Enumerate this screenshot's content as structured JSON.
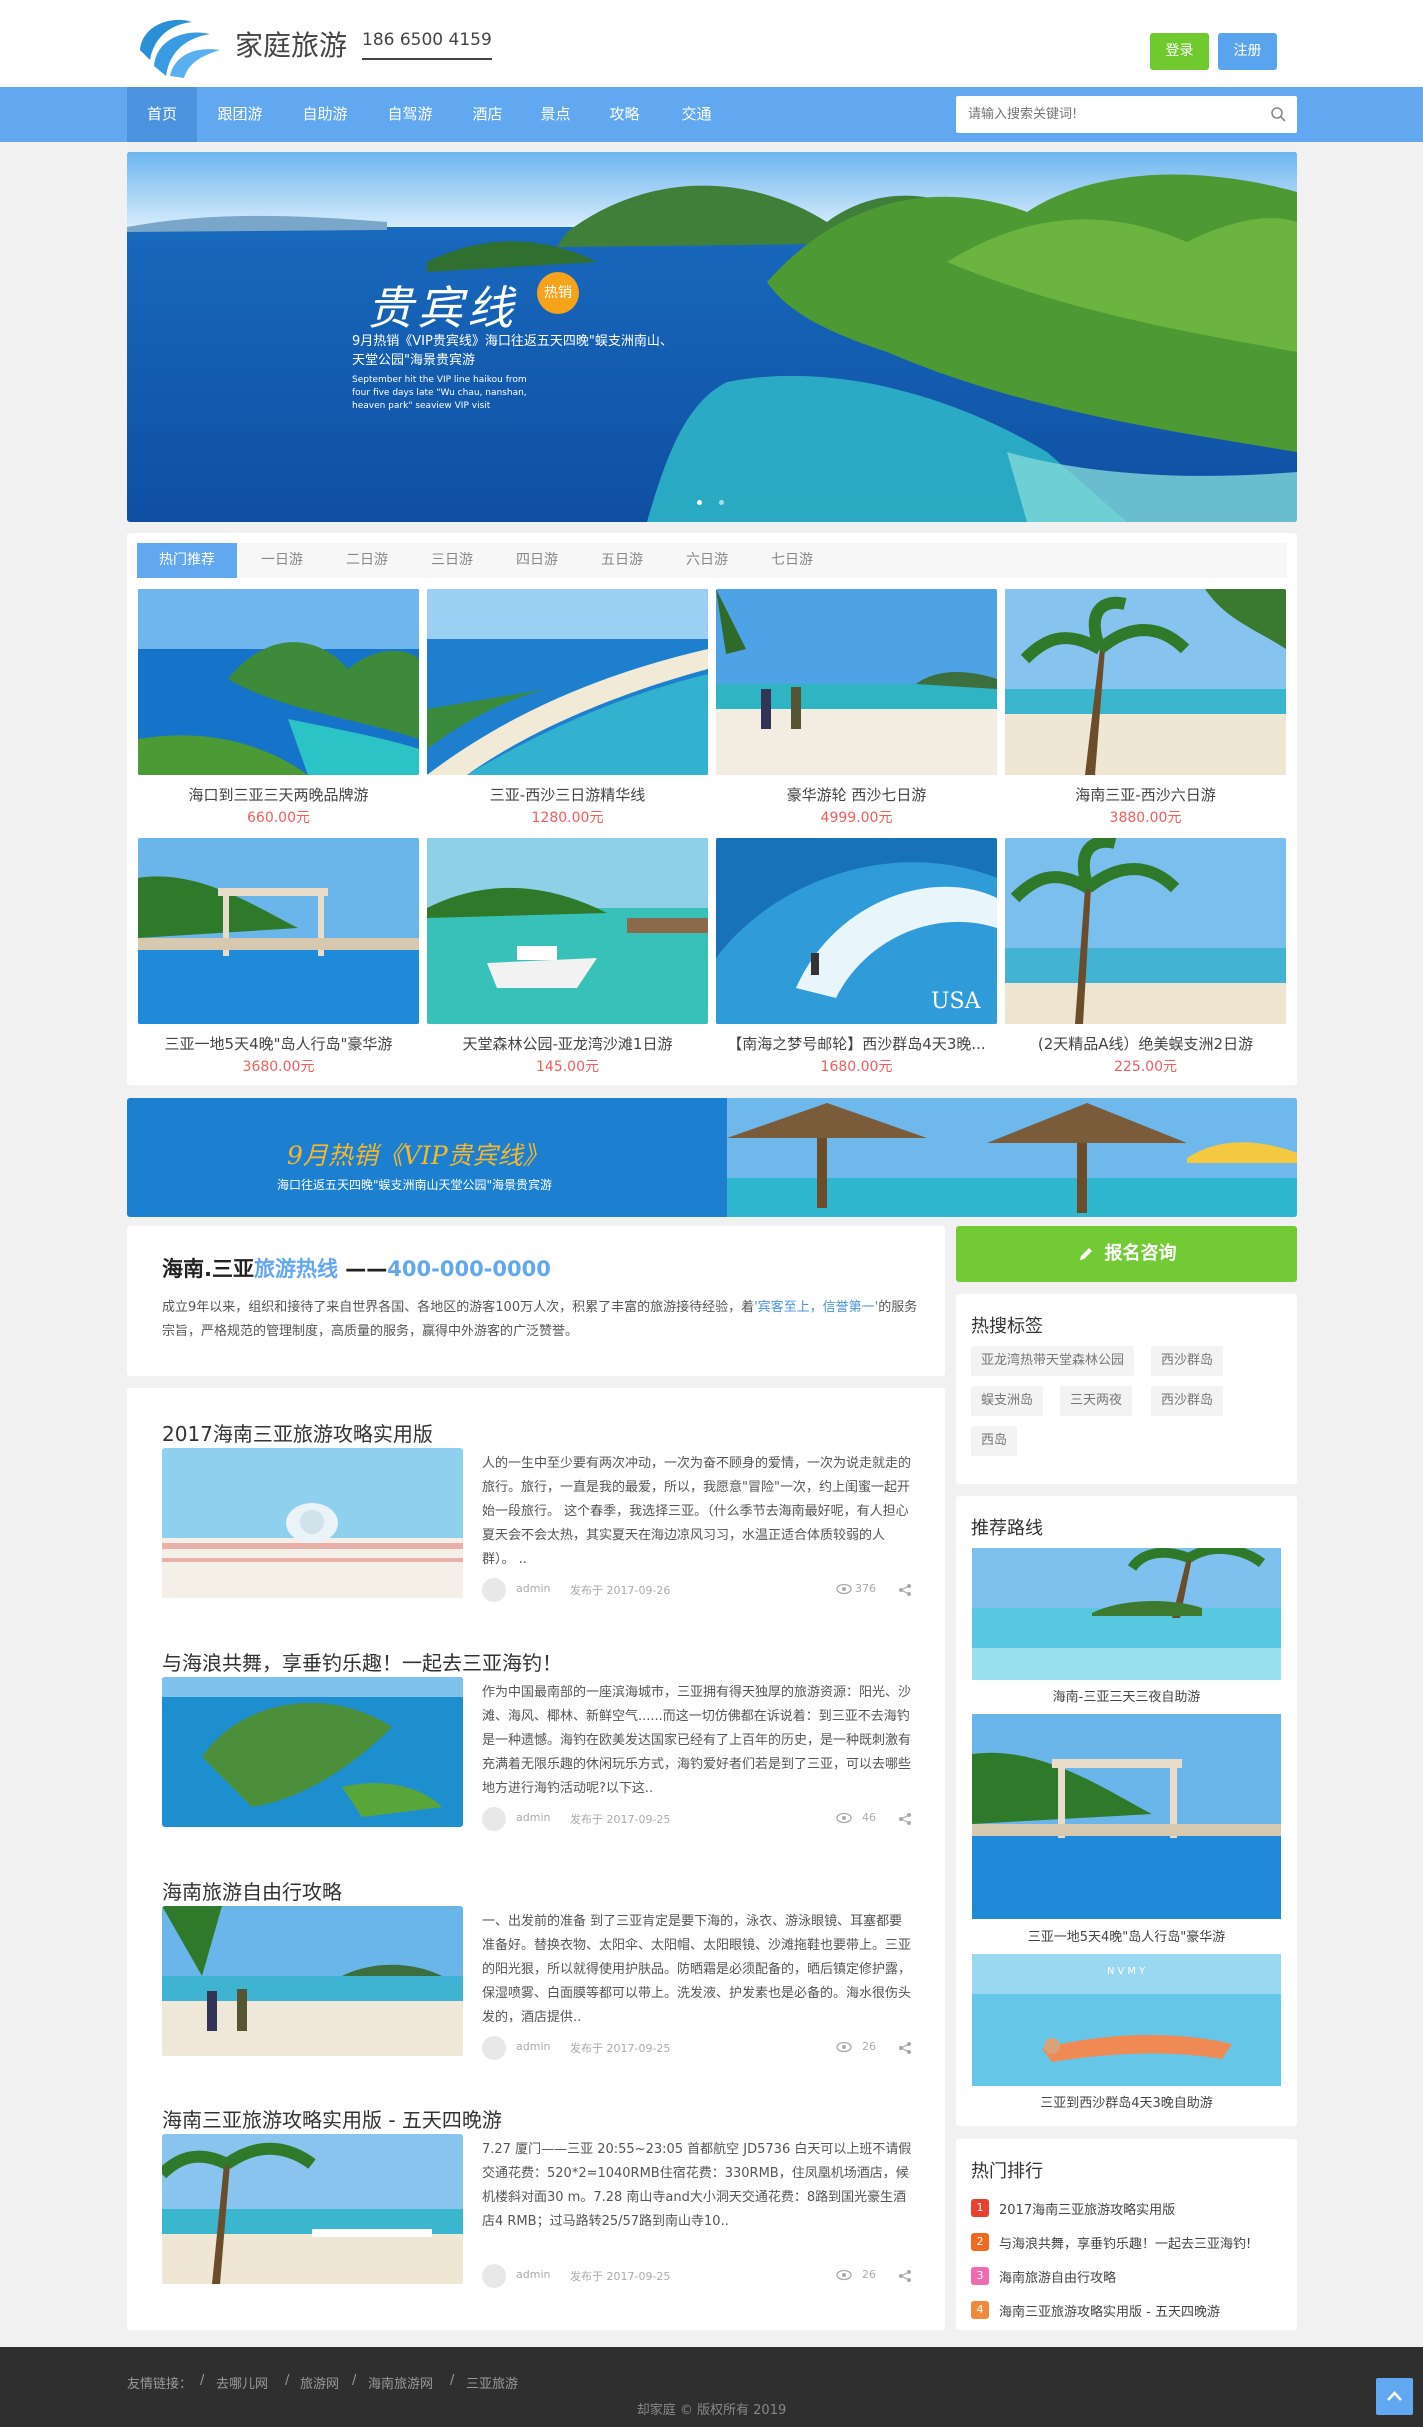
{
  "header": {
    "site_name": "家庭旅游",
    "phone": "186 6500 4159",
    "login": "登录",
    "register": "注册"
  },
  "nav": {
    "items": [
      "首页",
      "跟团游",
      "自助游",
      "自驾游",
      "酒店",
      "景点",
      "攻略",
      "交通"
    ],
    "active": "首页"
  },
  "search": {
    "placeholder": "请输入搜索关键词!"
  },
  "banner": {
    "title": "贵宾线",
    "badge": "热销",
    "subtitle": "9月热销《VIP贵宾线》海口往返五天四晚\"蜈支洲南山、天堂公园\"海景贵宾游",
    "subtitle_en": "September hit the VIP line haikou from four five days late \"Wu chau, nanshan, heaven park\" seaview VIP visit"
  },
  "hot": {
    "tabs": [
      "热门推荐",
      "一日游",
      "二日游",
      "三日游",
      "四日游",
      "五日游",
      "六日游",
      "七日游"
    ],
    "products": [
      {
        "title": "海口到三亚三天两晚品牌游",
        "price": "660.00元"
      },
      {
        "title": "三亚-西沙三日游精华线",
        "price": "1280.00元"
      },
      {
        "title": "豪华游轮 西沙七日游",
        "price": "4999.00元"
      },
      {
        "title": "海南三亚-西沙六日游",
        "price": "3880.00元"
      },
      {
        "title": "三亚一地5天4晚\"岛人行岛\"豪华游",
        "price": "3680.00元"
      },
      {
        "title": "天堂森林公园-亚龙湾沙滩1日游",
        "price": "145.00元"
      },
      {
        "title": "【南海之梦号邮轮】西沙群岛4天3晚...",
        "price": "1680.00元"
      },
      {
        "title": "(2天精品A线）绝美蜈支洲2日游",
        "price": "225.00元"
      }
    ],
    "usa_watermark": "USA"
  },
  "vip": {
    "title": "9月热销《VIP贵宾线》",
    "subtitle": "海口往返五天四晚\"蜈支洲南山天堂公园\"海景贵宾游"
  },
  "hotline": {
    "name": "海南.三亚",
    "label": "旅游热线",
    "dash": "——",
    "number": "400-000-0000",
    "text_a": "成立9年以来，组织和接待了来自世界各国、各地区的游客100万人次，积累了丰富的旅游接待经验，着",
    "text_b": "'宾客至上，信誉第一'",
    "text_c": "的服务宗旨，严格规范的管理制度，高质量的服务，赢得中外游客的广泛赞誉。"
  },
  "articles": [
    {
      "title": "2017海南三亚旅游攻略实用版",
      "excerpt": "人的一生中至少要有两次冲动，一次为奋不顾身的爱情，一次为说走就走的旅行。旅行，一直是我的最爱，所以，我愿意\"冒险\"一次，约上闺蜜一起开始一段旅行。 这个春季，我选择三亚。（什么季节去海南最好呢，有人担心夏天会不会太热，其实夏天在海边凉风习习，水温正适合体质较弱的人群）。 ..",
      "author": "admin",
      "date": "发布于 2017-09-26",
      "views": "376"
    },
    {
      "title": "与海浪共舞，享垂钓乐趣！一起去三亚海钓！",
      "excerpt": "作为中国最南部的一座滨海城市，三亚拥有得天独厚的旅游资源：阳光、沙滩、海风、椰林、新鲜空气......而这一切仿佛都在诉说着：到三亚不去海钓是一种遗憾。海钓在欧美发达国家已经有了上百年的历史，是一种既刺激有充满着无限乐趣的休闲玩乐方式，海钓爱好者们若是到了三亚，可以去哪些地方进行海钓活动呢?以下这..",
      "author": "admin",
      "date": "发布于 2017-09-25",
      "views": "46"
    },
    {
      "title": "海南旅游自由行攻略",
      "excerpt": "一、出发前的准备 到了三亚肯定是要下海的，泳衣、游泳眼镜、耳塞都要准备好。替换衣物、太阳伞、太阳帽、太阳眼镜、沙滩拖鞋也要带上。三亚的阳光狠，所以就得使用护肤品。防晒霜是必须配备的，晒后镇定修护露，保湿喷雾、白面膜等都可以带上。洗发液、护发素也是必备的。海水很伤头发的，酒店提供..",
      "author": "admin",
      "date": "发布于 2017-09-25",
      "views": "26"
    },
    {
      "title": "海南三亚旅游攻略实用版 - 五天四晚游",
      "excerpt": "7.27 厦门——三亚 20:55~23:05 首都航空 JD5736 白天可以上班不请假交通花费：520*2=1040RMB住宿花费：330RMB，住凤凰机场酒店，候机楼斜对面30 m。7.28 南山寺and大小洞天交通花费：8路到国光豪生酒店4 RMB；过马路转25/57路到南山寺10..",
      "author": "admin",
      "date": "发布于 2017-09-25",
      "views": "26"
    }
  ],
  "sidebar": {
    "consult": "报名咨询",
    "tags_title": "热搜标签",
    "tags": [
      "亚龙湾热带天堂森林公园",
      "西沙群岛",
      "蜈支洲岛",
      "三天两夜",
      "西沙群岛",
      "西岛"
    ],
    "rec_title": "推荐路线",
    "rec": [
      {
        "title": "海南-三亚三天三夜自助游"
      },
      {
        "title": "三亚一地5天4晚\"岛人行岛\"豪华游"
      },
      {
        "title": "三亚到西沙群岛4天3晚自助游"
      }
    ],
    "nvmy": "NVMY",
    "rank_title": "热门排行",
    "ranks": [
      {
        "num": "1",
        "title": "2017海南三亚旅游攻略实用版"
      },
      {
        "num": "2",
        "title": "与海浪共舞，享垂钓乐趣！一起去三亚海钓!"
      },
      {
        "num": "3",
        "title": "海南旅游自由行攻略"
      },
      {
        "num": "4",
        "title": "海南三亚旅游攻略实用版 - 五天四晚游"
      }
    ]
  },
  "footer": {
    "links_label": "友情链接：",
    "sep": "/",
    "links": [
      "去哪儿网",
      "旅游网",
      "海南旅游网",
      "三亚旅游"
    ],
    "copyright": "却家庭 © 版权所有 2019"
  },
  "colors": {
    "brand_blue": "#62a8f0",
    "login_green": "#71c930",
    "price_red": "#f45b5b",
    "rank_colors": [
      "#e8412c",
      "#f06a1f",
      "#f06ab2",
      "#f08a3c"
    ]
  }
}
